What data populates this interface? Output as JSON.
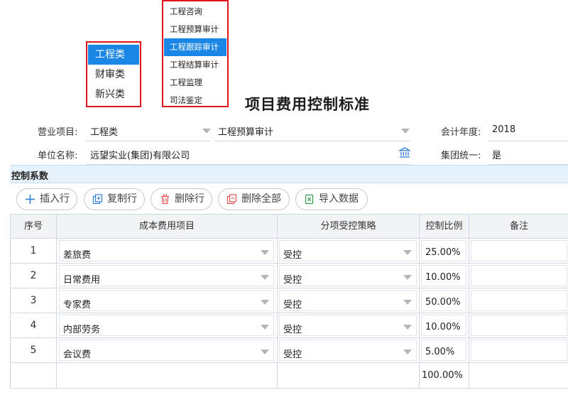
{
  "menu_category": {
    "items": [
      "工程类",
      "财审类",
      "新兴类"
    ],
    "selected_index": 0
  },
  "menu_subcategory": {
    "items": [
      "工程咨询",
      "工程预算审计",
      "工程跟踪审计",
      "工程结算审计",
      "工程监理",
      "司法鉴定"
    ],
    "selected_index": 2
  },
  "title": "项目费用控制标准",
  "form": {
    "business_item_label": "营业项目:",
    "business_item_value": "工程类",
    "business_sub_value": "工程预算审计",
    "fiscal_year_label": "会计年度:",
    "fiscal_year_value": "2018",
    "unit_name_label": "单位名称:",
    "unit_name_value": "远望实业(集团)有限公司",
    "group_unified_label": "集团统一:",
    "group_unified_value": "是"
  },
  "section_title": "控制系数",
  "toolbar": {
    "insert_row": "插入行",
    "copy_row": "复制行",
    "delete_row": "删除行",
    "delete_all": "删除全部",
    "import_data": "导入数据"
  },
  "table": {
    "headers": [
      "序号",
      "成本费用项目",
      "分项受控策略",
      "控制比例",
      "备注"
    ],
    "rows": [
      {
        "no": "1",
        "item": "差旅费",
        "strategy": "受控",
        "ratio": "25.00%",
        "note": ""
      },
      {
        "no": "2",
        "item": "日常费用",
        "strategy": "受控",
        "ratio": "10.00%",
        "note": ""
      },
      {
        "no": "3",
        "item": "专家费",
        "strategy": "受控",
        "ratio": "50.00%",
        "note": ""
      },
      {
        "no": "4",
        "item": "内部劳务",
        "strategy": "受控",
        "ratio": "10.00%",
        "note": ""
      },
      {
        "no": "5",
        "item": "会议费",
        "strategy": "受控",
        "ratio": "5.00%",
        "note": ""
      }
    ],
    "total_ratio": "100.00%"
  },
  "colors": {
    "accent": "#1a86e6",
    "highlight_border": "#e0161c",
    "section_bg": "#e6f2fb"
  }
}
